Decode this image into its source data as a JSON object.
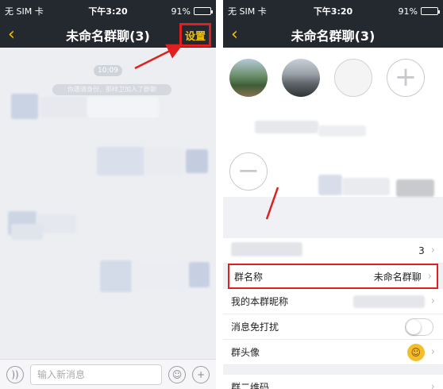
{
  "left_screen": {
    "status": {
      "carrier": "无 SIM 卡",
      "time": "下午3:20",
      "battery": "91%",
      "battery_fraction": 0.91
    },
    "nav": {
      "title": "未命名群聊(3)",
      "settings_label": "设置"
    },
    "chat": {
      "time_chip": "10:09",
      "system_note": "你邀请身份、那样卫加入了群聊"
    },
    "input": {
      "placeholder": "输入新消息"
    }
  },
  "right_screen": {
    "status": {
      "carrier": "无 SIM 卡",
      "time": "下午3:20",
      "battery": "91%",
      "battery_fraction": 0.91
    },
    "nav": {
      "title": "未命名群聊(3)"
    },
    "members_count": "3",
    "rows": {
      "group_name_label": "群名称",
      "group_name_value": "未命名群聊",
      "my_nickname_label": "我的本群昵称",
      "mute_label": "消息免打扰",
      "mute_enabled": false,
      "group_avatar_label": "群头像",
      "qr_label": "群二维码"
    }
  },
  "colors": {
    "nav_bg": "#24282f",
    "accent_yellow": "#f5c400",
    "highlight_red": "#e02020"
  },
  "icons": {
    "back": "chevron-left-icon",
    "voice": "voice-icon",
    "emoji": "smile-icon",
    "plus": "plus-icon",
    "chevron": "chevron-right-icon"
  }
}
